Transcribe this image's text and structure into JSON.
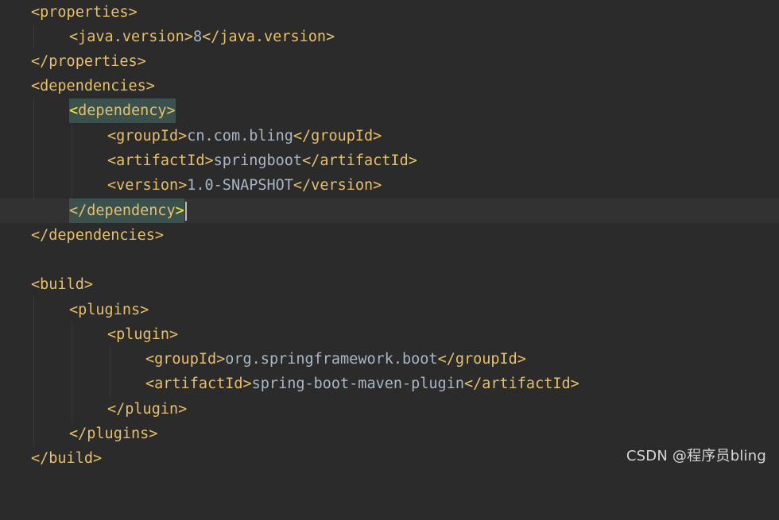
{
  "editor": {
    "lines": [
      {
        "open": "<properties>",
        "text": "",
        "close": ""
      },
      {
        "open": "<java.version>",
        "text": "8",
        "close": "</java.version>"
      },
      {
        "open": "</properties>",
        "text": "",
        "close": ""
      },
      {
        "open": "<dependencies>",
        "text": "",
        "close": ""
      },
      {
        "open_lt": "<",
        "open_rest": "dependency>"
      },
      {
        "open": "<groupId>",
        "text": "cn.com.bling",
        "close": "</groupId>"
      },
      {
        "open": "<artifactId>",
        "text": "springboot",
        "close": "</artifactId>"
      },
      {
        "open": "<version>",
        "text": "1.0-SNAPSHOT",
        "close": "</version>"
      },
      {
        "close_main": "</dependency",
        "close_gt": ">"
      },
      {
        "open": "</dependencies>",
        "text": "",
        "close": ""
      },
      {
        "open": "",
        "text": "",
        "close": ""
      },
      {
        "open": "<build>",
        "text": "",
        "close": ""
      },
      {
        "open": "<plugins>",
        "text": "",
        "close": ""
      },
      {
        "open": "<plugin>",
        "text": "",
        "close": ""
      },
      {
        "open": "<groupId>",
        "text": "org.springframework.boot",
        "close": "</groupId>"
      },
      {
        "open": "<artifactId>",
        "text": "spring-boot-maven-plugin",
        "close": "</artifactId>"
      },
      {
        "open": "</plugin>",
        "text": "",
        "close": ""
      },
      {
        "open": "</plugins>",
        "text": "",
        "close": ""
      },
      {
        "open": "</build>",
        "text": "",
        "close": ""
      }
    ]
  },
  "watermark": "CSDN @程序员bling",
  "colors": {
    "background": "#2b2b2b",
    "tag": "#e8bf6a",
    "text": "#a9b7c6",
    "tag_match_highlight": "#3b514d",
    "brace_match": "#ffef28",
    "current_line": "#323232"
  }
}
